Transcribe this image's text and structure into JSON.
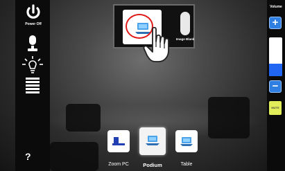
{
  "left_sidebar": {
    "power": {
      "label": "Power Off",
      "icon": "power-icon"
    },
    "microphone": {
      "icon": "microphone-icon"
    },
    "lights": {
      "icon": "light-bulb-icon"
    },
    "shades": {
      "icon": "window-shades-icon"
    },
    "help": {
      "label": "?"
    }
  },
  "projector": {
    "thumbnail_icon": "laptop-icon",
    "blank": {
      "label": "Image Blank"
    }
  },
  "volume": {
    "label": "Volume",
    "up": "+",
    "down": "−",
    "level": 0.33,
    "mute": "MUTE"
  },
  "sources": [
    {
      "label": "Zoom PC",
      "icon": "zoom-pc-icon",
      "selected": false
    },
    {
      "label": "Podium",
      "icon": "laptop-icon",
      "selected": true
    },
    {
      "label": "Table",
      "icon": "laptop-icon",
      "selected": false
    }
  ],
  "colors": {
    "accent_blue": "#2f7fe3",
    "volume_fill": "#2166f2",
    "mute_yellow": "#e1ee5a",
    "highlight_red": "#e01818"
  }
}
